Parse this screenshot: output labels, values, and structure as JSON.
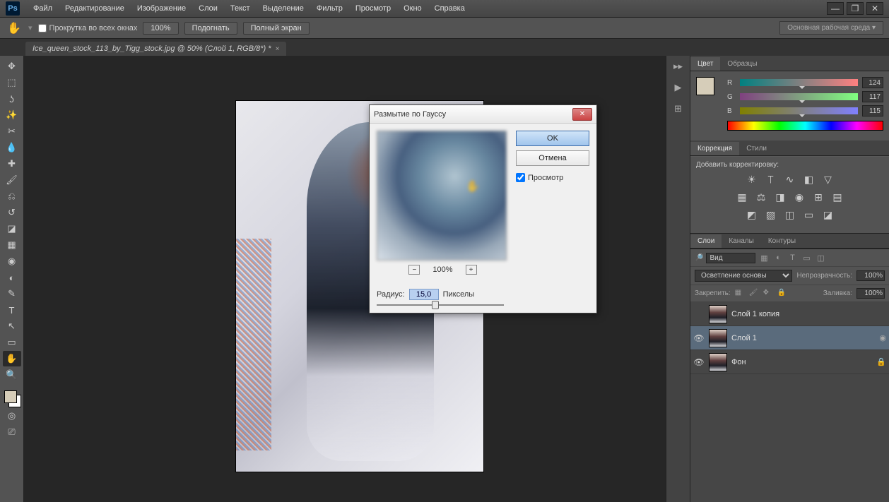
{
  "app": {
    "logo": "Ps"
  },
  "menu": {
    "items": [
      "Файл",
      "Редактирование",
      "Изображение",
      "Слои",
      "Текст",
      "Выделение",
      "Фильтр",
      "Просмотр",
      "Окно",
      "Справка"
    ]
  },
  "options_bar": {
    "scroll_all": "Прокрутка во всех окнах",
    "zoom": "100%",
    "fit": "Подогнать",
    "fullscreen": "Полный экран",
    "workspace": "Основная рабочая среда"
  },
  "document": {
    "tab_title": "Ice_queen_stock_113_by_Tigg_stock.jpg @ 50% (Слой 1, RGB/8*) *"
  },
  "dialog": {
    "title": "Размытие по Гауссу",
    "ok": "OK",
    "cancel": "Отмена",
    "preview": "Просмотр",
    "zoom": "100%",
    "radius_label": "Радиус:",
    "radius_value": "15,0",
    "radius_unit": "Пикселы"
  },
  "panels": {
    "color_tab": "Цвет",
    "swatches_tab": "Образцы",
    "adjustments_tab": "Коррекция",
    "styles_tab": "Стили",
    "add_adjustment": "Добавить корректировку:",
    "layers_tab": "Слои",
    "channels_tab": "Каналы",
    "paths_tab": "Контуры"
  },
  "color": {
    "r": {
      "label": "R",
      "value": "124"
    },
    "g": {
      "label": "G",
      "value": "117"
    },
    "b": {
      "label": "B",
      "value": "115"
    }
  },
  "layers_panel": {
    "filter_kind": "Вид",
    "blend_mode": "Осветление основы",
    "opacity_label": "Непрозрачность:",
    "opacity_value": "100%",
    "lock_label": "Закрепить:",
    "fill_label": "Заливка:",
    "fill_value": "100%",
    "layers": [
      {
        "name": "Слой 1 копия",
        "visible": false,
        "locked": false,
        "selected": false
      },
      {
        "name": "Слой 1",
        "visible": true,
        "locked": false,
        "selected": true
      },
      {
        "name": "Фон",
        "visible": true,
        "locked": true,
        "selected": false
      }
    ]
  }
}
